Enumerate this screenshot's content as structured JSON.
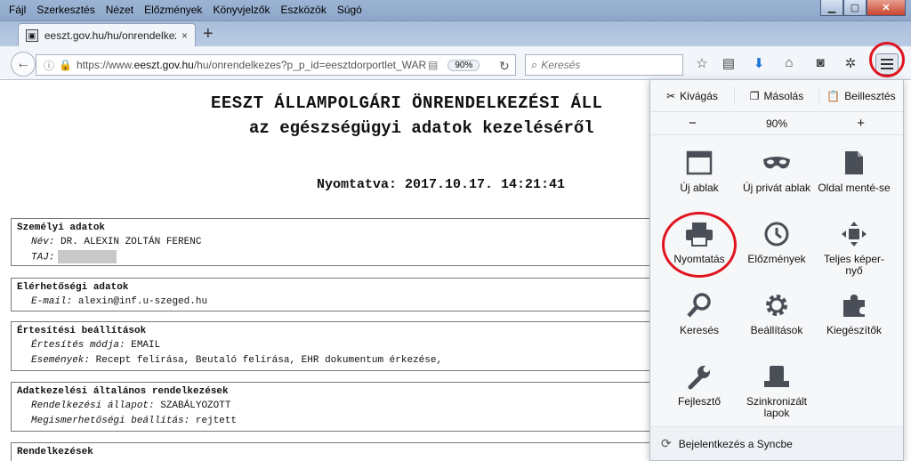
{
  "menubar": [
    "Fájl",
    "Szerkesztés",
    "Nézet",
    "Előzmények",
    "Könyvjelzők",
    "Eszközök",
    "Súgó"
  ],
  "tab": {
    "title": "eeszt.gov.hu/hu/onrendelkez",
    "close": "×",
    "new_tab": "+"
  },
  "nav": {
    "url_prefix": "https://www.",
    "url_domain": "eeszt.gov.hu",
    "url_rest": "/hu/onrendelkezes?p_p_id=eesztdorportlet_WAR",
    "zoom": "90%",
    "search_placeholder": "Keresés"
  },
  "document": {
    "title": "EESZT ÁLLAMPOLGÁRI ÖNRENDELKEZÉSI ÁLL",
    "subtitle": "az egészségügyi adatok kezeléséről",
    "printed": "Nyomtatva: 2017.10.17. 14:21:41",
    "sections": {
      "personal": {
        "title": "Személyi adatok",
        "name_label": "Név:",
        "name_value": "DR. ALEXIN ZOLTÁN FERENC",
        "taj_label": "TAJ:"
      },
      "contact": {
        "title": "Elérhetőségi adatok",
        "email_label": "E-mail:",
        "email_value": "alexin@inf.u-szeged.hu"
      },
      "notify": {
        "title": "Értesítési beállítások",
        "mode_label": "Értesítés módja:",
        "mode_value": "EMAIL",
        "events_label": "Események:",
        "events_value": "Recept felírása, Beutaló felírása, EHR dokumentum érkezése,"
      },
      "general": {
        "title": "Adatkezelési általános rendelkezések",
        "state_label": "Rendelkezési állapot:",
        "state_value": "SZABÁLYOZOTT",
        "visibility_label": "Megismerhetőségi beállítás:",
        "visibility_value": "rejtett"
      },
      "orders": {
        "title": "Rendelkezések"
      }
    }
  },
  "panel": {
    "cut": "Kivágás",
    "copy": "Másolás",
    "paste": "Beillesztés",
    "zoom_out": "−",
    "zoom_value": "90%",
    "zoom_in": "+",
    "items": {
      "new_window": "Új ablak",
      "private_window": "Új privát ablak",
      "save_page": "Oldal menté-se",
      "print": "Nyomtatás",
      "history": "Előzmények",
      "fullscreen": "Teljes képer-nyő",
      "find": "Keresés",
      "options": "Beállítások",
      "addons": "Kiegészítők",
      "developer": "Fejlesztő",
      "synced_tabs": "Szinkronizált lapok"
    },
    "sync": "Bejelentkezés a Syncbe"
  },
  "colors": {
    "highlight_ring": "#e0141e",
    "icon_gray": "#4a4f57"
  }
}
